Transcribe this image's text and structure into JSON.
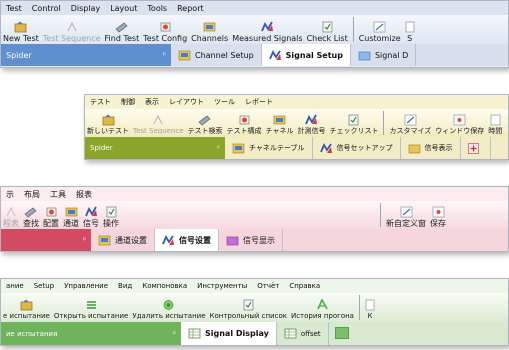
{
  "english": {
    "menu": [
      "Test",
      "Control",
      "Display",
      "Layout",
      "Tools",
      "Report"
    ],
    "toolbar": [
      {
        "label": "New Test",
        "icon": "new-test-icon",
        "enabled": true
      },
      {
        "label": "Test Sequence",
        "icon": "test-sequence-icon",
        "enabled": false
      },
      {
        "label": "Find Test",
        "icon": "find-test-icon",
        "enabled": true
      },
      {
        "label": "Test Config",
        "icon": "test-config-icon",
        "enabled": true
      },
      {
        "label": "Channels",
        "icon": "channels-icon",
        "enabled": true
      },
      {
        "label": "Measured Signals",
        "icon": "measured-signals-icon",
        "enabled": true
      },
      {
        "label": "Check List",
        "icon": "check-list-icon",
        "enabled": true
      },
      {
        "label": "Customize",
        "icon": "customize-icon",
        "enabled": true
      },
      {
        "label": "S",
        "icon": "save-icon",
        "enabled": true
      }
    ],
    "panel": {
      "title": "Spider",
      "pin": "ᵖ"
    },
    "tabs": [
      {
        "label": "Channel Setup",
        "icon": "channel-setup-icon",
        "active": false
      },
      {
        "label": "Signal Setup",
        "icon": "signal-setup-icon",
        "active": true
      },
      {
        "label": "Signal D",
        "icon": "signal-display-icon",
        "active": false
      }
    ]
  },
  "japanese": {
    "menu": [
      "テスト",
      "制御",
      "表示",
      "レイアウト",
      "ツール",
      "レポート"
    ],
    "toolbar": [
      {
        "label": "新しいテスト",
        "icon": "new-test-icon",
        "enabled": true
      },
      {
        "label": "Test Sequence",
        "icon": "test-sequence-icon",
        "enabled": false
      },
      {
        "label": "テスト検索",
        "icon": "find-test-icon",
        "enabled": true
      },
      {
        "label": "テスト構成",
        "icon": "test-config-icon",
        "enabled": true
      },
      {
        "label": "チャネル",
        "icon": "channels-icon",
        "enabled": true
      },
      {
        "label": "計測信号",
        "icon": "measured-signals-icon",
        "enabled": true
      },
      {
        "label": "チェックリスト",
        "icon": "check-list-icon",
        "enabled": true
      },
      {
        "label": "カスタマイズ",
        "icon": "customize-icon",
        "enabled": true
      },
      {
        "label": "ウィンドウ保存",
        "icon": "save-window-icon",
        "enabled": true
      },
      {
        "label": "時間",
        "icon": "time-icon",
        "enabled": true
      }
    ],
    "panel": {
      "title": "Spider",
      "pin": "ᵖ"
    },
    "tabs": [
      {
        "label": "チャネルテーブル",
        "icon": "channel-table-icon",
        "active": false
      },
      {
        "label": "信号セットアップ",
        "icon": "signal-setup-icon",
        "active": false
      },
      {
        "label": "信号表示",
        "icon": "signal-display-icon",
        "active": false
      }
    ]
  },
  "chinese": {
    "menu": [
      "示",
      "布局",
      "工具",
      "报表"
    ],
    "toolbar": [
      {
        "label": "程表",
        "icon": "test-sequence-icon",
        "enabled": false
      },
      {
        "label": "查找",
        "icon": "find-test-icon",
        "enabled": true
      },
      {
        "label": "配置",
        "icon": "test-config-icon",
        "enabled": true
      },
      {
        "label": "通道",
        "icon": "channels-icon",
        "enabled": true
      },
      {
        "label": "信号",
        "icon": "measured-signals-icon",
        "enabled": true
      },
      {
        "label": "操作",
        "icon": "check-list-icon",
        "enabled": true
      },
      {
        "label": "新自定义窗",
        "icon": "customize-icon",
        "enabled": true
      },
      {
        "label": "保存",
        "icon": "save-icon",
        "enabled": true
      }
    ],
    "panel": {
      "pin": "ᵖ"
    },
    "tabs": [
      {
        "label": "通道设置",
        "icon": "channel-setup-icon",
        "active": false
      },
      {
        "label": "信号设置",
        "icon": "signal-setup-icon",
        "active": true
      },
      {
        "label": "信号显示",
        "icon": "signal-display-icon",
        "active": false
      }
    ]
  },
  "russian": {
    "menu": [
      "ание",
      "Setup",
      "Управление",
      "Вид",
      "Компоновка",
      "Инструменты",
      "Отчёт",
      "Справка"
    ],
    "toolbar": [
      {
        "label": "е испытание",
        "icon": "new-test-icon",
        "enabled": true
      },
      {
        "label": "Открыть испытание",
        "icon": "open-test-icon",
        "enabled": true
      },
      {
        "label": "Удалить испытание",
        "icon": "delete-test-icon",
        "enabled": true
      },
      {
        "label": "Контрольный список",
        "icon": "check-list-icon",
        "enabled": true
      },
      {
        "label": "История прогона",
        "icon": "run-history-icon",
        "enabled": true
      },
      {
        "label": "К",
        "icon": "more-icon",
        "enabled": true
      }
    ],
    "panel": {
      "title": "ие испытания",
      "pin": "ᵖ"
    },
    "tabs": [
      {
        "label": "Signal Display",
        "icon": "signal-display-icon",
        "active": true
      },
      {
        "label": "offset",
        "icon": "offset-icon",
        "active": false
      }
    ]
  }
}
